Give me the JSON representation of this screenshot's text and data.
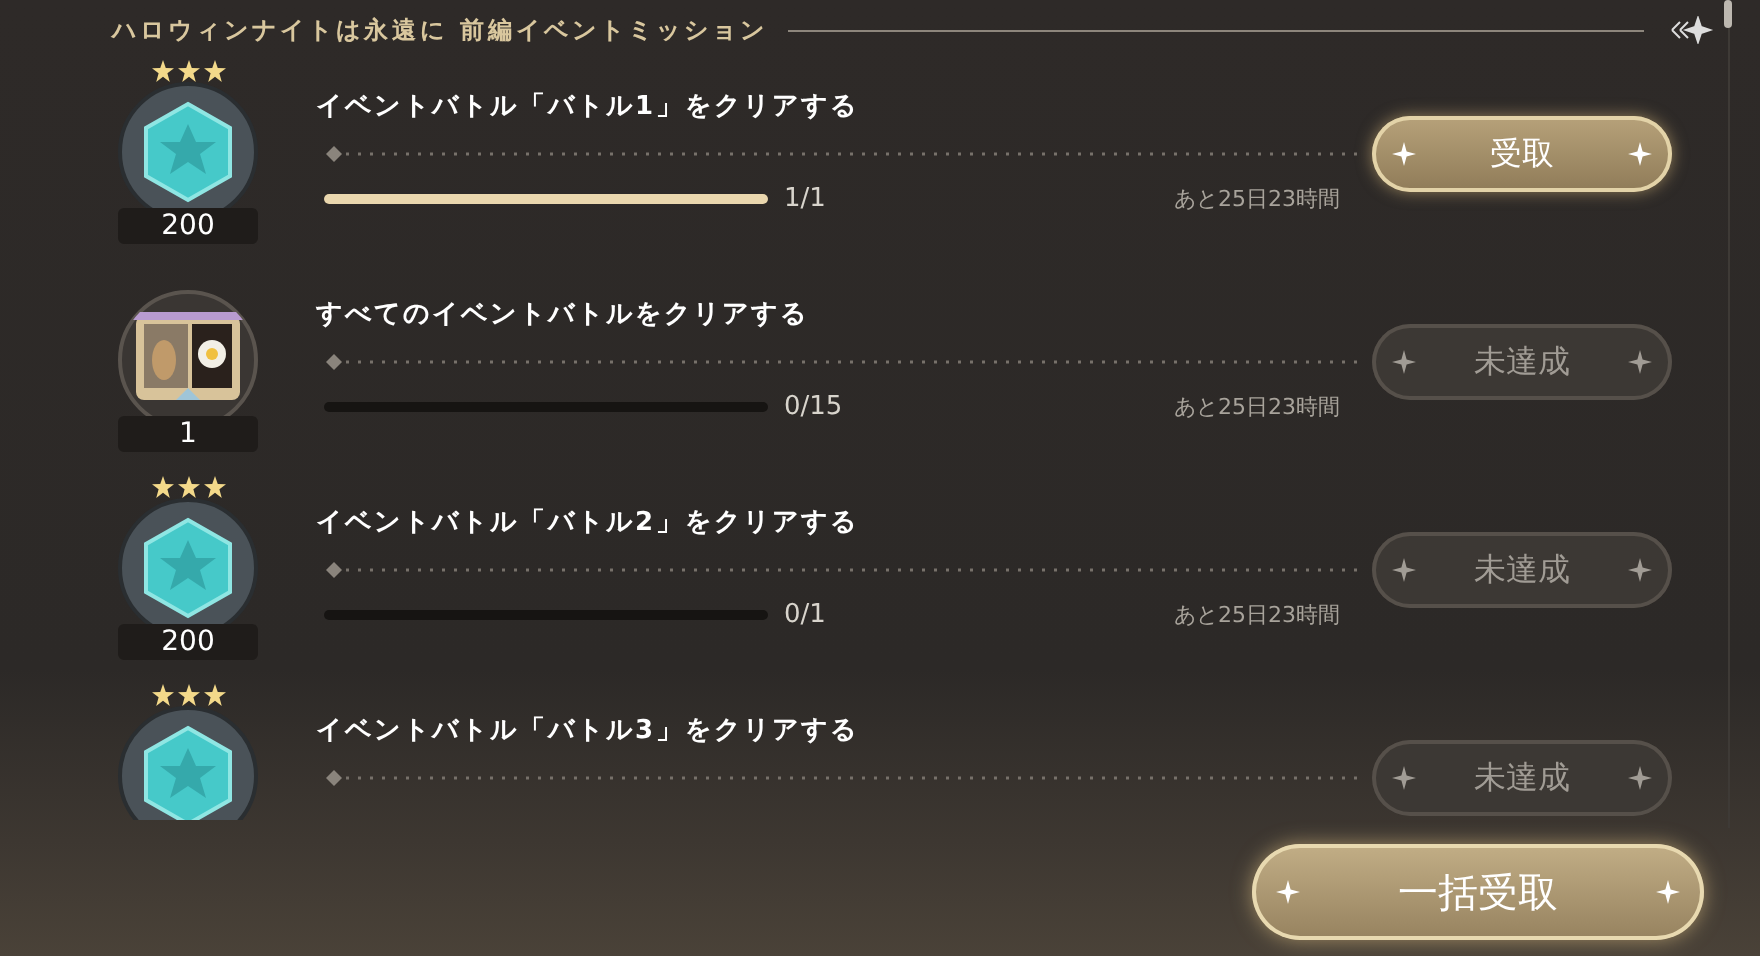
{
  "header": {
    "title": "ハロウィンナイトは永遠に 前編イベントミッション"
  },
  "missions": [
    {
      "title": "イベントバトル「バトル1」をクリアする",
      "reward": {
        "kind": "gem",
        "stars": 3,
        "count": "200"
      },
      "progress": {
        "level": 1,
        "reading": "1/1"
      },
      "time_left": "あと25日23時間",
      "button": {
        "label": "受取",
        "disabled": false
      }
    },
    {
      "title": "すべてのイベントバトルをクリアする",
      "reward": {
        "kind": "picture",
        "count": "1"
      },
      "progress": {
        "level": 0,
        "reading": "0/15"
      },
      "time_left": "あと25日23時間",
      "button": {
        "label": "未達成",
        "disabled": true
      }
    },
    {
      "title": "イベントバトル「バトル2」をクリアする",
      "reward": {
        "kind": "gem",
        "stars": 3,
        "count": "200"
      },
      "progress": {
        "level": 0,
        "reading": "0/1"
      },
      "time_left": "あと25日23時間",
      "button": {
        "label": "未達成",
        "disabled": true
      }
    },
    {
      "title": "イベントバトル「バトル3」をクリアする",
      "reward": {
        "kind": "gem",
        "stars": 3
      },
      "button": {
        "label": "未達成",
        "disabled": true
      }
    }
  ],
  "claim_all_button": {
    "label": "一括受取"
  }
}
